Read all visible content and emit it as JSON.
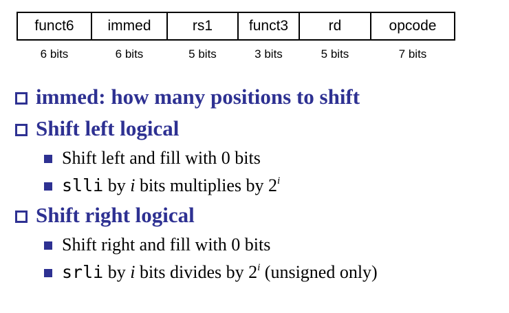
{
  "format": {
    "fields": [
      "funct6",
      "immed",
      "rs1",
      "funct3",
      "rd",
      "opcode"
    ],
    "bits": [
      "6 bits",
      "6 bits",
      "5 bits",
      "3 bits",
      "5 bits",
      "7 bits"
    ]
  },
  "bullets": {
    "immed": {
      "term": "immed:",
      "rest": " how many positions to shift"
    },
    "sll": {
      "title": "Shift left logical",
      "sub1": "Shift left and fill with 0 bits",
      "sub2": {
        "code": "slli",
        "text_a": " by ",
        "var": "i",
        "text_b": " bits multiplies by 2",
        "sup": "i"
      }
    },
    "srl": {
      "title": "Shift right logical",
      "sub1": "Shift right and fill with 0 bits",
      "sub2": {
        "code": "srli",
        "text_a": " by ",
        "var": "i",
        "text_b": " bits divides by 2",
        "sup": "i",
        "text_c": " (unsigned only)"
      }
    }
  },
  "colors": {
    "heading": "#2e3192",
    "bullet_hollow": "#2e3192",
    "bullet_filled": "#2e3192"
  },
  "icons": {
    "level1_bullet": "hollow-square-icon",
    "level2_bullet": "filled-square-icon"
  }
}
